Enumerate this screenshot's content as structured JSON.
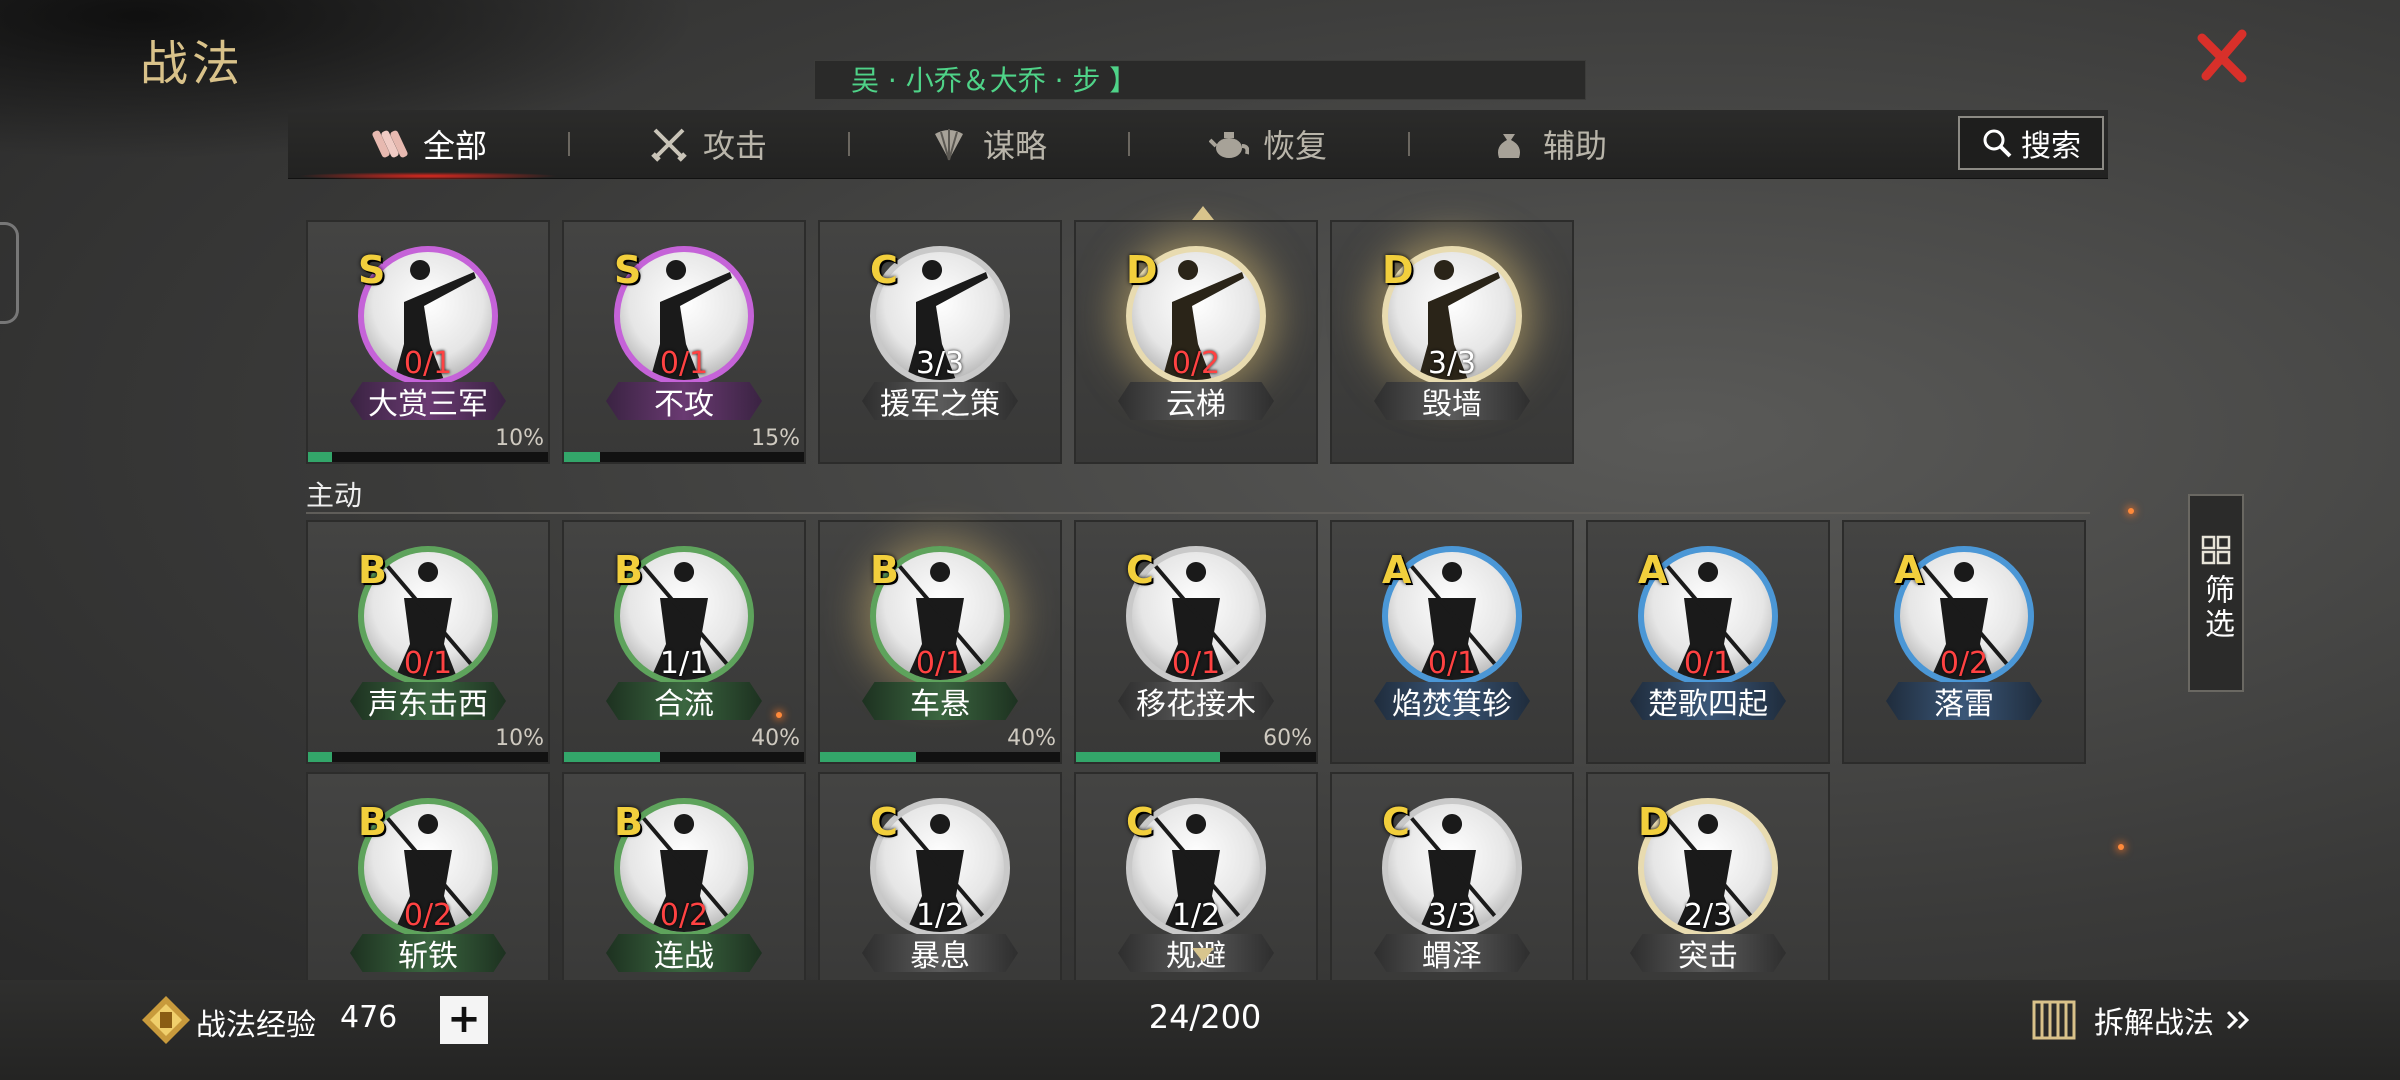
{
  "title": "战法",
  "banner_text": "吴 · 小乔＆大乔 · 步 】",
  "tabs": [
    {
      "label": "全部",
      "icon": "scroll-bundle-icon"
    },
    {
      "label": "攻击",
      "icon": "crossed-swords-icon"
    },
    {
      "label": "谋略",
      "icon": "feather-fan-icon"
    },
    {
      "label": "恢复",
      "icon": "teapot-icon"
    },
    {
      "label": "辅助",
      "icon": "pouch-icon"
    }
  ],
  "active_tab": "全部",
  "search_label": "搜索",
  "section_label": "主动",
  "filter_label": "筛选",
  "cards_row1": [
    {
      "grade": "S",
      "count": "0/1",
      "name": "大赏三军",
      "progress_label": "10%",
      "progress": 10
    },
    {
      "grade": "S",
      "count": "0/1",
      "name": "不攻",
      "progress_label": "15%",
      "progress": 15
    },
    {
      "grade": "C",
      "count": "3/3",
      "name": "援军之策"
    },
    {
      "grade": "D",
      "count": "0/2",
      "name": "云梯"
    },
    {
      "grade": "D",
      "count": "3/3",
      "name": "毁墙"
    }
  ],
  "cards_row2": [
    {
      "grade": "B",
      "count": "0/1",
      "name": "声东击西",
      "progress_label": "10%",
      "progress": 10
    },
    {
      "grade": "B",
      "count": "1/1",
      "name": "合流",
      "progress_label": "40%",
      "progress": 40
    },
    {
      "grade": "B",
      "count": "0/1",
      "name": "车悬",
      "progress_label": "40%",
      "progress": 40
    },
    {
      "grade": "C",
      "count": "0/1",
      "name": "移花接木",
      "progress_label": "60%",
      "progress": 60
    },
    {
      "grade": "A",
      "count": "0/1",
      "name": "焰焚箕轸"
    },
    {
      "grade": "A",
      "count": "0/1",
      "name": "楚歌四起"
    },
    {
      "grade": "A",
      "count": "0/2",
      "name": "落雷"
    }
  ],
  "cards_row3": [
    {
      "grade": "B",
      "count": "0/2",
      "name": "斩铁"
    },
    {
      "grade": "B",
      "count": "0/2",
      "name": "连战"
    },
    {
      "grade": "C",
      "count": "1/2",
      "name": "暴息"
    },
    {
      "grade": "C",
      "count": "1/2",
      "name": "规避"
    },
    {
      "grade": "C",
      "count": "3/3",
      "name": "蝟泽"
    },
    {
      "grade": "D",
      "count": "2/3",
      "name": "突击"
    }
  ],
  "bottom": {
    "exp_label": "战法经验",
    "exp_value": "476",
    "capacity": "24/200",
    "decompose_label": "拆解战法"
  },
  "colors": {
    "grade_text": "#f2cf3c",
    "count_red": "#ff4242",
    "banner_green": "#4fd388",
    "progress_green": "#33a66a",
    "close_red": "#d8302a",
    "title_gold": "#d9c28a"
  }
}
